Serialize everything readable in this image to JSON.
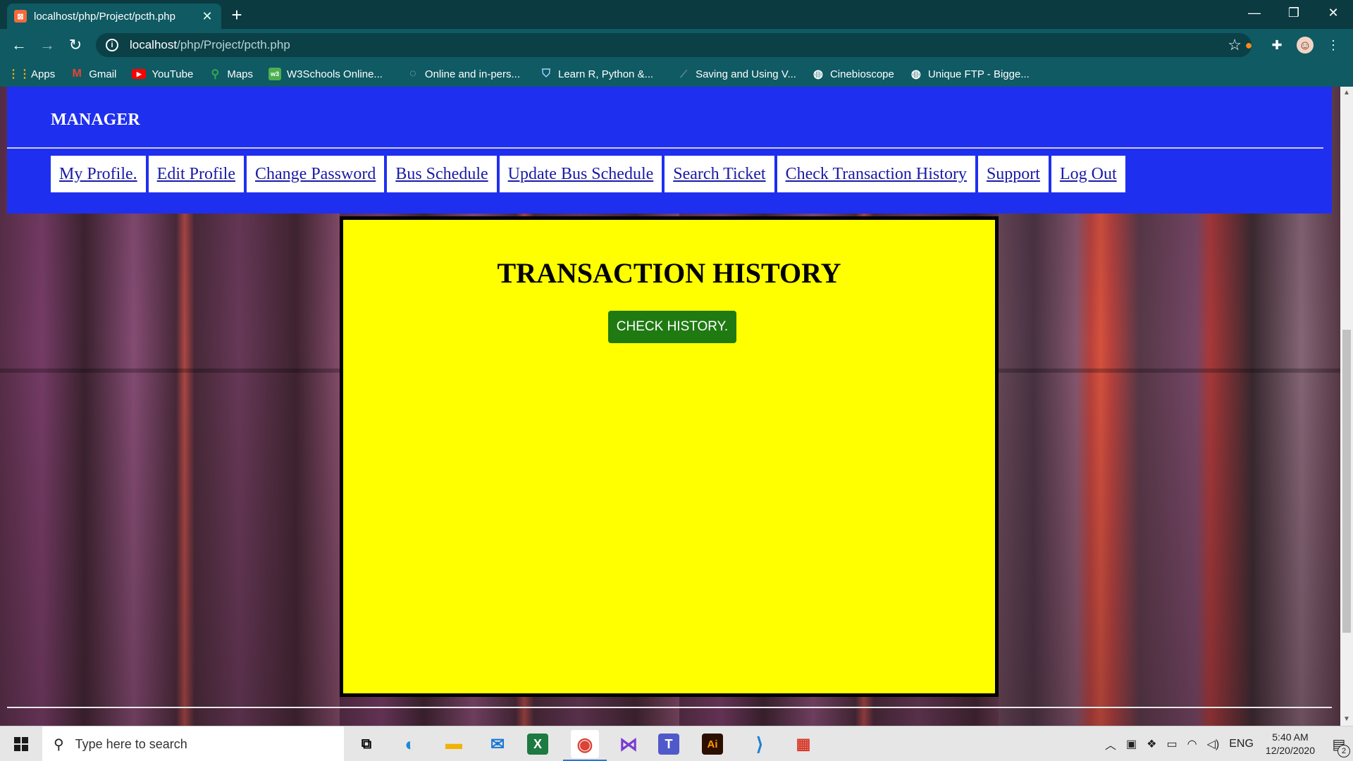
{
  "browser": {
    "tab_title": "localhost/php/Project/pcth.php",
    "tab_close": "✕",
    "new_tab": "+",
    "url_host": "localhost",
    "url_path": "/php/Project/pcth.php",
    "bookmarks": [
      {
        "label": "Apps",
        "icon": "apps-grid-icon"
      },
      {
        "label": "Gmail",
        "icon": "gmail-icon"
      },
      {
        "label": "YouTube",
        "icon": "youtube-icon"
      },
      {
        "label": "Maps",
        "icon": "maps-icon"
      },
      {
        "label": "W3Schools Online...",
        "icon": "w3schools-icon"
      },
      {
        "label": "Online and in-pers...",
        "icon": "link-icon"
      },
      {
        "label": "Learn R, Python &...",
        "icon": "shield-icon"
      },
      {
        "label": "Saving and Using V...",
        "icon": "link-icon"
      },
      {
        "label": "Cinebioscope",
        "icon": "globe-icon"
      },
      {
        "label": "Unique FTP - Bigge...",
        "icon": "globe-icon"
      }
    ]
  },
  "page": {
    "role_heading": "MANAGER",
    "nav": [
      "My Profile.",
      "Edit Profile",
      "Change Password",
      "Bus Schedule",
      "Update Bus Schedule",
      "Search Ticket",
      "Check Transaction History",
      "Support",
      "Log Out"
    ],
    "panel_title": "TRANSACTION HISTORY",
    "check_button": "CHECK HISTORY."
  },
  "taskbar": {
    "search_placeholder": "Type here to search",
    "language": "ENG",
    "time": "5:40 AM",
    "date": "12/20/2020",
    "notification_count": "2"
  },
  "colors": {
    "header_blue": "#1f2ff0",
    "panel_yellow": "#ffff00",
    "button_green": "#1f7a12"
  }
}
